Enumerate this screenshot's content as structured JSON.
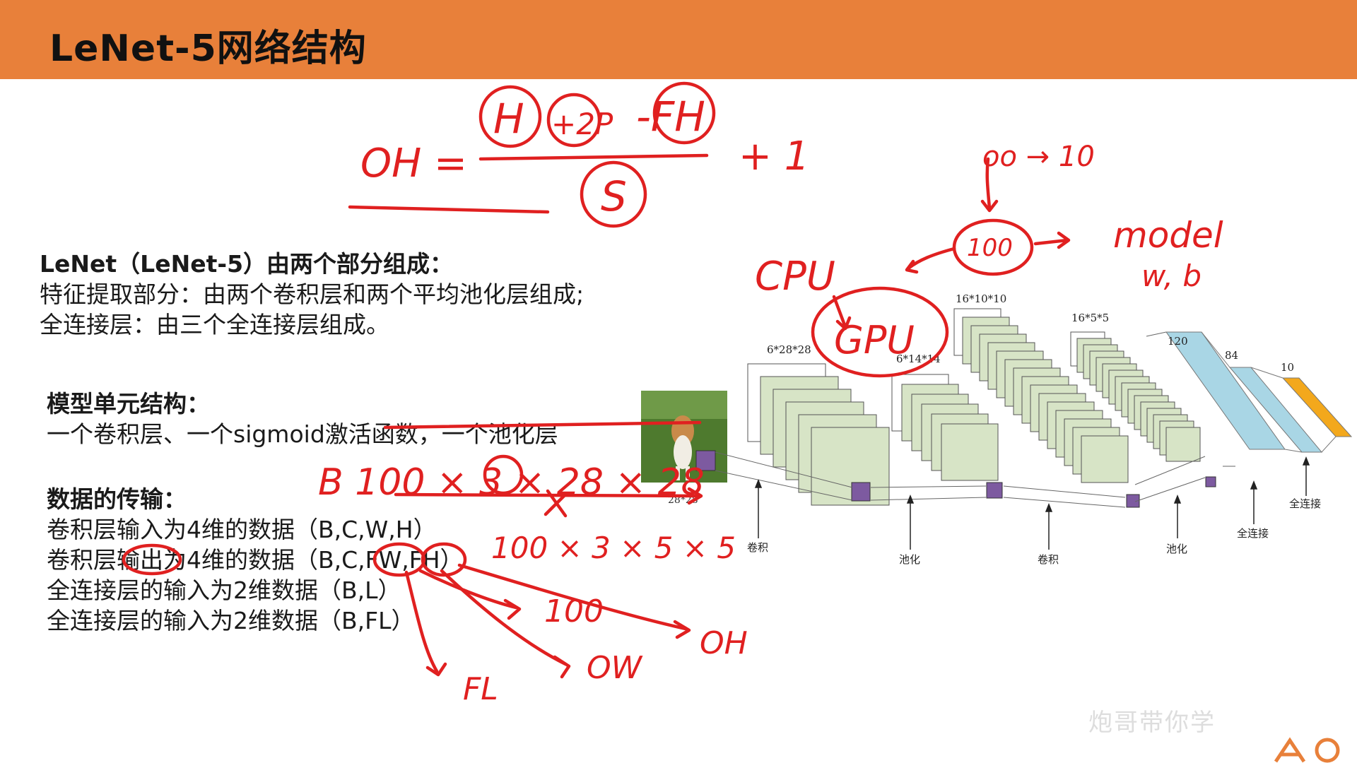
{
  "header": {
    "title": "LeNet-5网络结构"
  },
  "intro": {
    "heading": "LeNet（LeNet-5）由两个部分组成：",
    "line1": "特征提取部分：由两个卷积层和两个平均池化层组成;",
    "line2": "全连接层：由三个全连接层组成。"
  },
  "unit": {
    "heading": "模型单元结构：",
    "line1": "一个卷积层、一个sigmoid激活函数，一个池化层"
  },
  "data_transfer": {
    "heading": "数据的传输：",
    "lines": [
      "卷积层输入为4维的数据（B,C,W,H）",
      "卷积层输出为4维的数据（B,C,FW,FH）",
      "全连接层的输入为2维数据（B,L）",
      "全连接层的输入为2维数据（B,FL）"
    ]
  },
  "diagram": {
    "input_label": "28*28",
    "conv1_label": "6*28*28",
    "pool1_label": "6*14*14",
    "conv2_label": "16*10*10",
    "pool2_label": "16*5*5",
    "fc1_label": "120",
    "fc2_label": "84",
    "fc3_label": "10",
    "bottom_labels": [
      "卷积",
      "池化",
      "卷积",
      "池化",
      "全连接",
      "全连接"
    ]
  },
  "handwriting": {
    "formula_lhs": "OH =",
    "formula_num_h": "H",
    "formula_num_2p": "+2P",
    "formula_num_fh": "-FH",
    "formula_den": "S",
    "formula_plus": "+ 1",
    "top_right": "oo → 10",
    "circle_100": "100",
    "model": "model",
    "wb": "w, b",
    "cpu": "CPU",
    "gpu": "GPU",
    "shape_line": "B 100 × 3 × 28 × 28",
    "shape_line2": "100 × 3 × 5 × 5",
    "arrow_100": "100",
    "arrow_oh": "OH",
    "arrow_ow": "OW",
    "arrow_fl": "FL"
  },
  "watermark": "炮哥带你学",
  "colors": {
    "header": "#e8803a",
    "ink": "#e02020",
    "fc_blue": "#a9d6e5",
    "fc_orange": "#f3a81c",
    "map_fill": "#d7e4c6",
    "kernel": "#7d5aa0"
  }
}
